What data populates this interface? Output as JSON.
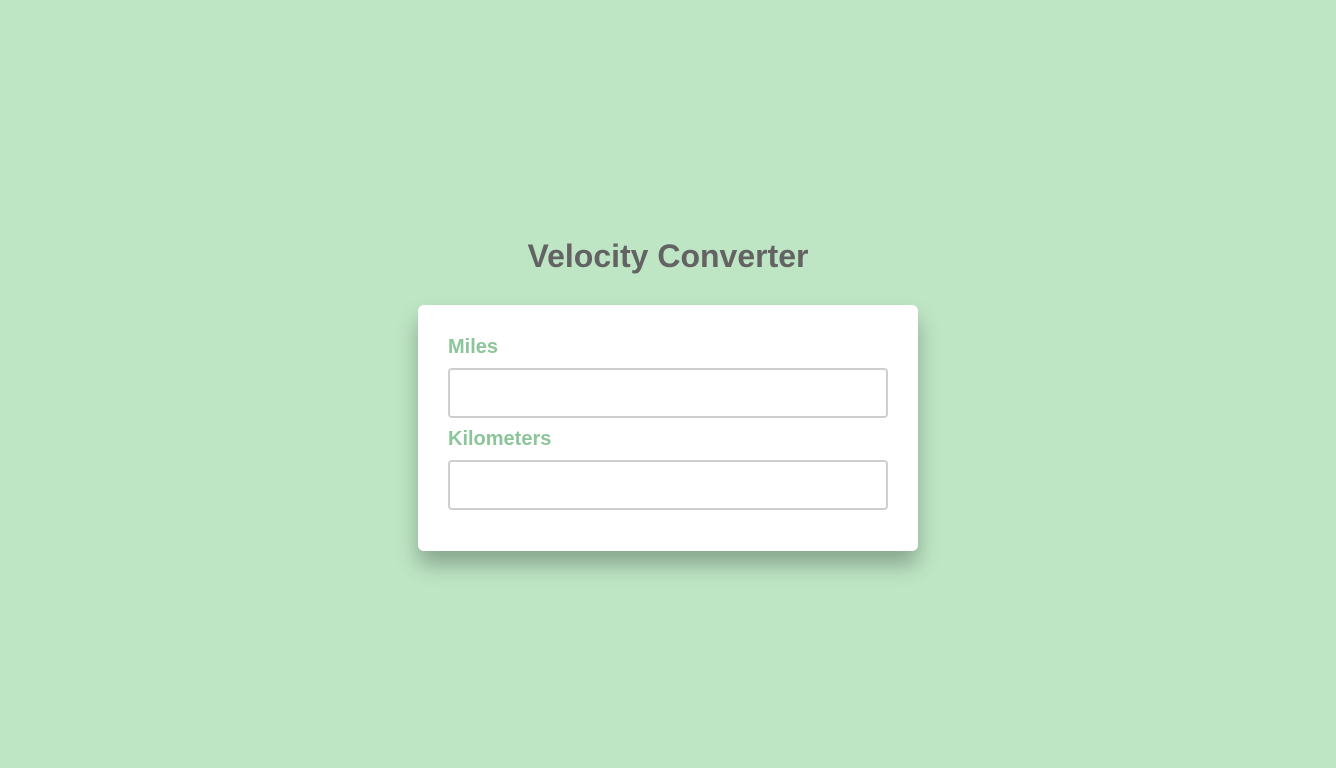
{
  "page": {
    "title": "Velocity Converter"
  },
  "converter": {
    "miles": {
      "label": "Miles",
      "value": "",
      "placeholder": ""
    },
    "kilometers": {
      "label": "Kilometers",
      "value": "",
      "placeholder": ""
    }
  },
  "colors": {
    "background": "#bee6c5",
    "title": "#636363",
    "label": "#8cc59a",
    "card": "#ffffff",
    "input_border": "#cfcfcf"
  }
}
